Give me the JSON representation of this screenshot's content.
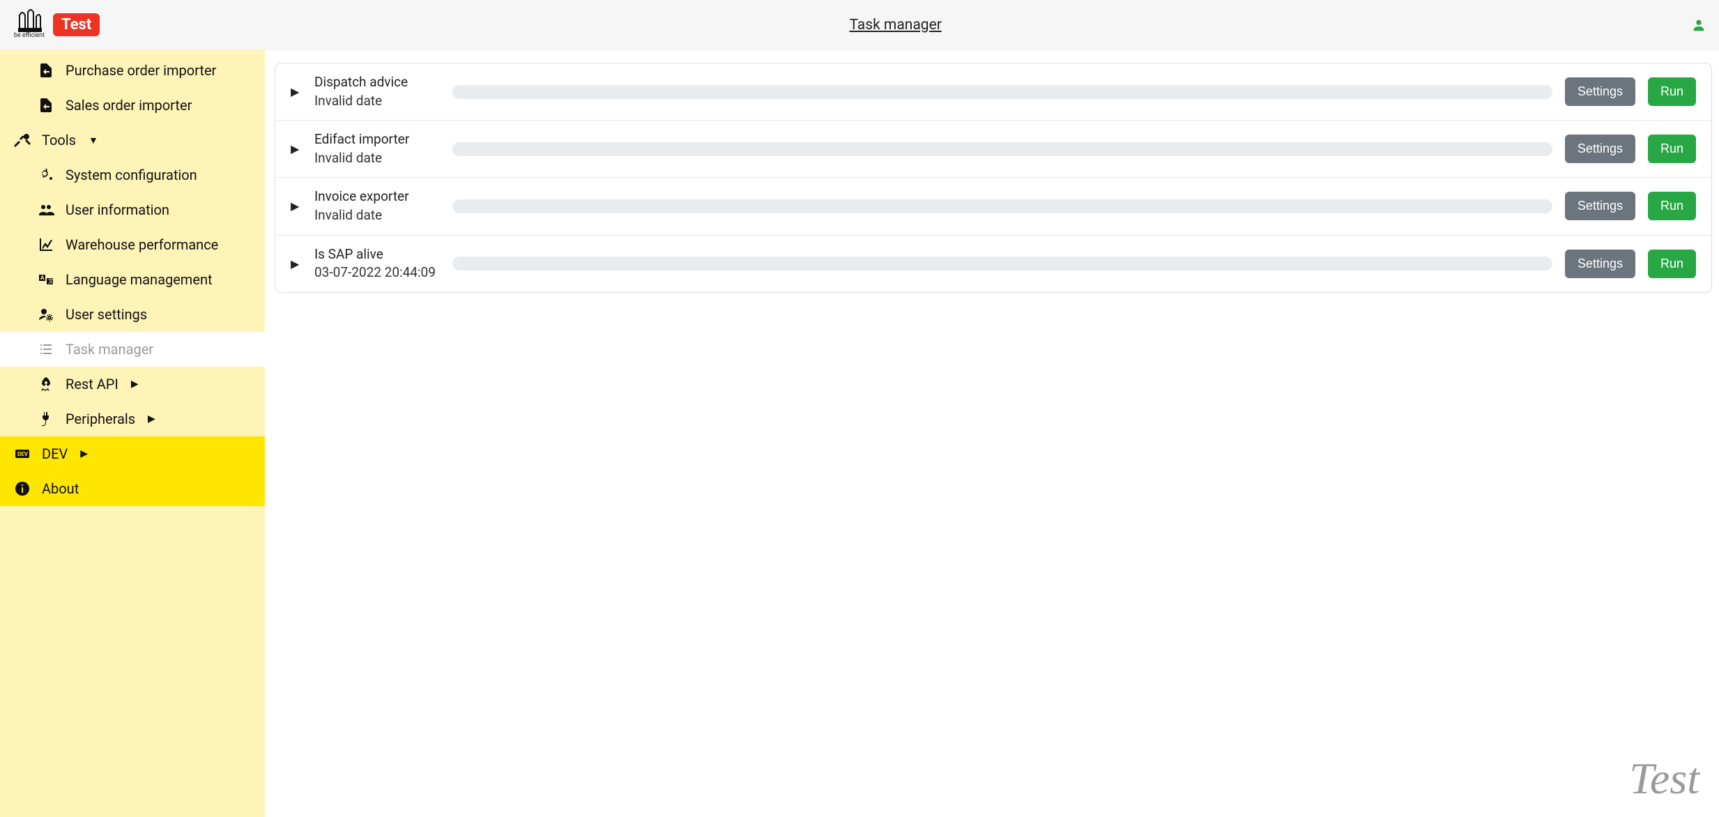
{
  "header": {
    "logo_sub": "be efficient",
    "env_badge": "Test",
    "title": "Task manager"
  },
  "sidebar": {
    "items": [
      {
        "label": "Purchase order importer",
        "icon": "file-import-icon",
        "level": 2
      },
      {
        "label": "Sales order importer",
        "icon": "file-import-icon",
        "level": 2
      },
      {
        "label": "Tools",
        "icon": "tools-icon",
        "level": 1,
        "caret": "down"
      },
      {
        "label": "System configuration",
        "icon": "cogs-icon",
        "level": 2
      },
      {
        "label": "User information",
        "icon": "users-icon",
        "level": 2
      },
      {
        "label": "Warehouse performance",
        "icon": "chart-icon",
        "level": 2
      },
      {
        "label": "Language management",
        "icon": "language-icon",
        "level": 2
      },
      {
        "label": "User settings",
        "icon": "user-cog-icon",
        "level": 2
      },
      {
        "label": "Task manager",
        "icon": "tasks-icon",
        "level": 2,
        "active": true
      },
      {
        "label": "Rest API",
        "icon": "rocket-icon",
        "level": 2,
        "caret": "right"
      },
      {
        "label": "Peripherals",
        "icon": "plug-icon",
        "level": 2,
        "caret": "right"
      },
      {
        "label": "DEV",
        "icon": "dev-icon",
        "level": 1,
        "caret": "right",
        "dev": true
      },
      {
        "label": "About",
        "icon": "info-icon",
        "level": 1,
        "dev": true
      }
    ]
  },
  "tasks": [
    {
      "name": "Dispatch advice",
      "date": "Invalid date"
    },
    {
      "name": "Edifact importer",
      "date": "Invalid date"
    },
    {
      "name": "Invoice exporter",
      "date": "Invalid date"
    },
    {
      "name": "Is SAP alive",
      "date": "03-07-2022 20:44:09"
    }
  ],
  "buttons": {
    "settings": "Settings",
    "run": "Run"
  },
  "watermark": "Test"
}
